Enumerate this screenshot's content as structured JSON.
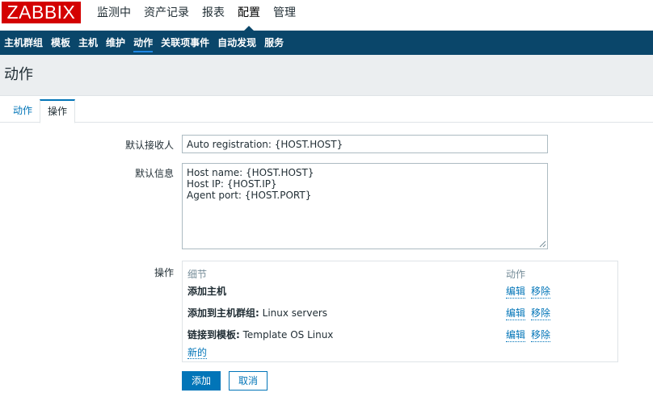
{
  "logo": "ZABBIX",
  "main_menu": [
    "监测中",
    "资产记录",
    "报表",
    "配置",
    "管理"
  ],
  "sub_nav": [
    "主机群组",
    "模板",
    "主机",
    "维护",
    "动作",
    "关联项事件",
    "自动发现",
    "服务"
  ],
  "page_title": "动作",
  "tabs": [
    "动作",
    "操作"
  ],
  "form": {
    "recipient_label": "默认接收人",
    "recipient_value": "Auto registration: {HOST.HOST}",
    "message_label": "默认信息",
    "message_lines": [
      "Host name: {HOST.HOST}",
      "Host IP: {HOST.IP}",
      "Agent port: {HOST.PORT}"
    ],
    "operations_label": "操作"
  },
  "operations": {
    "col_details": "细节",
    "col_action": "动作",
    "rows": [
      {
        "bold": "添加主机",
        "rest": ""
      },
      {
        "bold": "添加到主机群组:",
        "rest": " Linux servers"
      },
      {
        "bold": "链接到模板:",
        "rest": " Template OS Linux"
      }
    ],
    "edit_label": "编辑",
    "remove_label": "移除",
    "new_label": "新的"
  },
  "buttons": {
    "add": "添加",
    "cancel": "取消"
  },
  "colors": {
    "brand": "#d40000",
    "nav": "#0a466a",
    "accent": "#0275b8"
  }
}
